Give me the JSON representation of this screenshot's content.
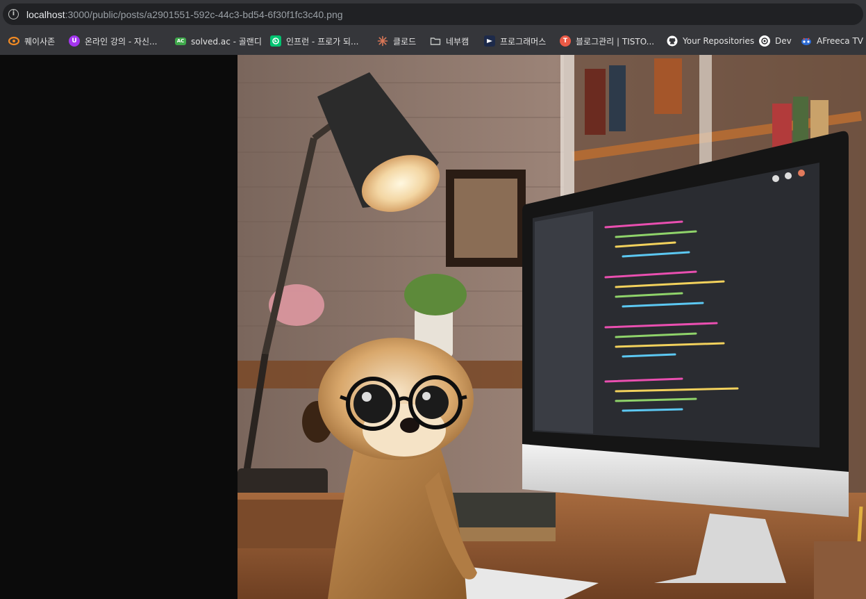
{
  "browser": {
    "url_host": "localhost",
    "url_path": ":3000/public/posts/a2901551-592c-44c3-bd54-6f30f1fc3c40.png",
    "info_icon": "i"
  },
  "bookmarks": [
    {
      "label": "퀘이사존",
      "icon": "quasarzone-icon",
      "color": "#f08a24"
    },
    {
      "label": "온라인 강의 - 자신...",
      "icon": "udemy-icon",
      "color": "#a435f0"
    },
    {
      "label": "solved.ac - 골랜디",
      "icon": "solvedac-icon",
      "color": "#3fa84b"
    },
    {
      "label": "인프런 - 프로가 되...",
      "icon": "inflearn-icon",
      "color": "#00c471"
    },
    {
      "label": "클로드",
      "icon": "claude-icon",
      "color": "#d97757"
    },
    {
      "label": "네부캠",
      "icon": "folder-icon",
      "color": "#c4c7c5"
    },
    {
      "label": "프로그래머스",
      "icon": "programmers-icon",
      "color": "#1d2a4a"
    },
    {
      "label": "블로그관리 | TISTO...",
      "icon": "tistory-icon",
      "color": "#eb5a46"
    },
    {
      "label": "Your Repositories",
      "icon": "github-icon",
      "color": "#ffffff"
    },
    {
      "label": "Dev",
      "icon": "openai-icon",
      "color": "#ffffff"
    },
    {
      "label": "AFreeca TV",
      "icon": "afreecatv-icon",
      "color": "#2e6dd6"
    }
  ],
  "content": {
    "image_subject": "meerkat-with-glasses-at-computer"
  }
}
